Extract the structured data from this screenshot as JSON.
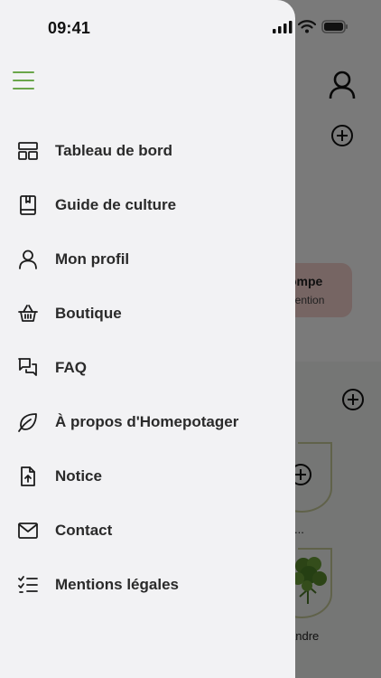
{
  "status_bar": {
    "time": "09:41"
  },
  "drawer": {
    "menu": [
      {
        "label": "Tableau de bord",
        "icon": "dashboard-icon"
      },
      {
        "label": "Guide de culture",
        "icon": "book-icon"
      },
      {
        "label": "Mon profil",
        "icon": "user-icon"
      },
      {
        "label": "Boutique",
        "icon": "basket-icon"
      },
      {
        "label": "FAQ",
        "icon": "chat-bubbles-icon"
      },
      {
        "label": "À propos d'Homepotager",
        "icon": "leaf-icon"
      },
      {
        "label": "Notice",
        "icon": "file-upload-icon"
      },
      {
        "label": "Contact",
        "icon": "mail-icon"
      },
      {
        "label": "Mentions légales",
        "icon": "checklist-icon"
      }
    ]
  },
  "background": {
    "alert_title": "ompe",
    "alert_subtitle": "ttention",
    "card_label_1": "...",
    "card_label_2": "andre"
  },
  "colors": {
    "accent": "#6aa64a",
    "drawer_bg": "#f2f2f4",
    "alert_bg": "#f6d3d0"
  }
}
